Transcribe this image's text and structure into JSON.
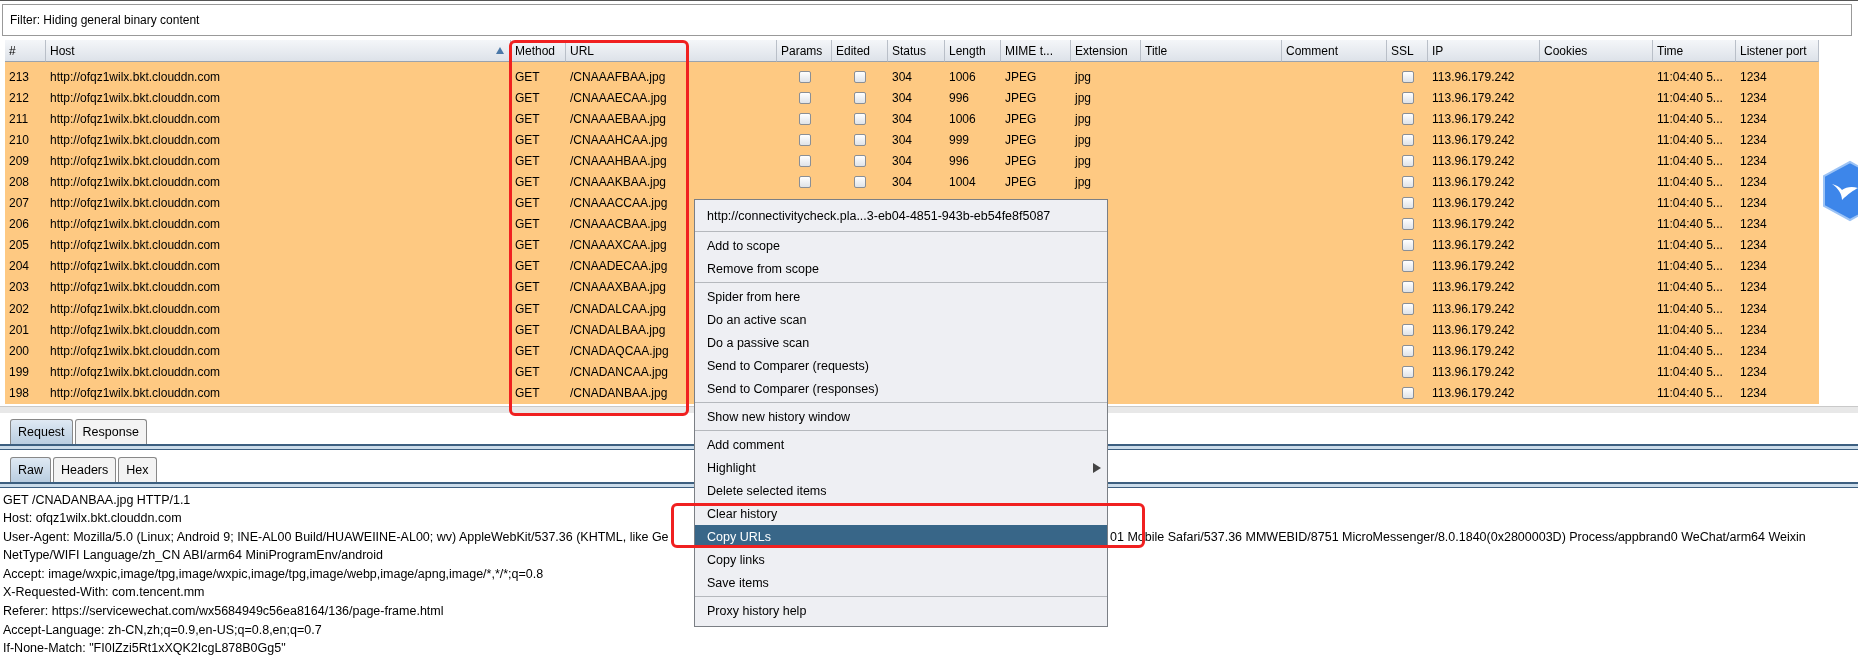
{
  "filter": {
    "text": "Filter: Hiding general binary content"
  },
  "table": {
    "columns": [
      {
        "label": "#",
        "sorted": false
      },
      {
        "label": "Host",
        "sorted": true
      },
      {
        "label": "Method",
        "sorted": false
      },
      {
        "label": "URL",
        "sorted": false
      },
      {
        "label": "Params",
        "sorted": false
      },
      {
        "label": "Edited",
        "sorted": false
      },
      {
        "label": "Status",
        "sorted": false
      },
      {
        "label": "Length",
        "sorted": false
      },
      {
        "label": "MIME t...",
        "sorted": false
      },
      {
        "label": "Extension",
        "sorted": false
      },
      {
        "label": "Title",
        "sorted": false
      },
      {
        "label": "Comment",
        "sorted": false
      },
      {
        "label": "SSL",
        "sorted": false
      },
      {
        "label": "IP",
        "sorted": false
      },
      {
        "label": "Cookies",
        "sorted": false
      },
      {
        "label": "Time",
        "sorted": false
      },
      {
        "label": "Listener port",
        "sorted": false
      }
    ],
    "rows": [
      {
        "num": "213",
        "host": "http://ofqz1wilx.bkt.clouddn.com",
        "method": "GET",
        "url": "/CNAAAFBAA.jpg",
        "params": false,
        "edited": false,
        "status": "304",
        "length": "1006",
        "mime": "JPEG",
        "extension": "jpg",
        "ssl": false,
        "ip": "113.96.179.242",
        "time": "11:04:40 5...",
        "port": "1234"
      },
      {
        "num": "212",
        "host": "http://ofqz1wilx.bkt.clouddn.com",
        "method": "GET",
        "url": "/CNAAAECAA.jpg",
        "params": false,
        "edited": false,
        "status": "304",
        "length": "996",
        "mime": "JPEG",
        "extension": "jpg",
        "ssl": false,
        "ip": "113.96.179.242",
        "time": "11:04:40 5...",
        "port": "1234"
      },
      {
        "num": "211",
        "host": "http://ofqz1wilx.bkt.clouddn.com",
        "method": "GET",
        "url": "/CNAAAEBAA.jpg",
        "params": false,
        "edited": false,
        "status": "304",
        "length": "1006",
        "mime": "JPEG",
        "extension": "jpg",
        "ssl": false,
        "ip": "113.96.179.242",
        "time": "11:04:40 5...",
        "port": "1234"
      },
      {
        "num": "210",
        "host": "http://ofqz1wilx.bkt.clouddn.com",
        "method": "GET",
        "url": "/CNAAAHCAA.jpg",
        "params": false,
        "edited": false,
        "status": "304",
        "length": "999",
        "mime": "JPEG",
        "extension": "jpg",
        "ssl": false,
        "ip": "113.96.179.242",
        "time": "11:04:40 5...",
        "port": "1234"
      },
      {
        "num": "209",
        "host": "http://ofqz1wilx.bkt.clouddn.com",
        "method": "GET",
        "url": "/CNAAAHBAA.jpg",
        "params": false,
        "edited": false,
        "status": "304",
        "length": "996",
        "mime": "JPEG",
        "extension": "jpg",
        "ssl": false,
        "ip": "113.96.179.242",
        "time": "11:04:40 5...",
        "port": "1234"
      },
      {
        "num": "208",
        "host": "http://ofqz1wilx.bkt.clouddn.com",
        "method": "GET",
        "url": "/CNAAAKBAA.jpg",
        "params": false,
        "edited": false,
        "status": "304",
        "length": "1004",
        "mime": "JPEG",
        "extension": "jpg",
        "ssl": false,
        "ip": "113.96.179.242",
        "time": "11:04:40 5...",
        "port": "1234"
      },
      {
        "num": "207",
        "host": "http://ofqz1wilx.bkt.clouddn.com",
        "method": "GET",
        "url": "/CNAAACCAA.jpg",
        "ssl": false,
        "ip": "113.96.179.242",
        "time": "11:04:40 5...",
        "port": "1234"
      },
      {
        "num": "206",
        "host": "http://ofqz1wilx.bkt.clouddn.com",
        "method": "GET",
        "url": "/CNAAACBAA.jpg",
        "ssl": false,
        "ip": "113.96.179.242",
        "time": "11:04:40 5...",
        "port": "1234"
      },
      {
        "num": "205",
        "host": "http://ofqz1wilx.bkt.clouddn.com",
        "method": "GET",
        "url": "/CNAAAXCAA.jpg",
        "ssl": false,
        "ip": "113.96.179.242",
        "time": "11:04:40 5...",
        "port": "1234"
      },
      {
        "num": "204",
        "host": "http://ofqz1wilx.bkt.clouddn.com",
        "method": "GET",
        "url": "/CNAADECAA.jpg",
        "ssl": false,
        "ip": "113.96.179.242",
        "time": "11:04:40 5...",
        "port": "1234"
      },
      {
        "num": "203",
        "host": "http://ofqz1wilx.bkt.clouddn.com",
        "method": "GET",
        "url": "/CNAAAXBAA.jpg",
        "ssl": false,
        "ip": "113.96.179.242",
        "time": "11:04:40 5...",
        "port": "1234"
      },
      {
        "num": "202",
        "host": "http://ofqz1wilx.bkt.clouddn.com",
        "method": "GET",
        "url": "/CNADALCAA.jpg",
        "ssl": false,
        "ip": "113.96.179.242",
        "time": "11:04:40 5...",
        "port": "1234"
      },
      {
        "num": "201",
        "host": "http://ofqz1wilx.bkt.clouddn.com",
        "method": "GET",
        "url": "/CNADALBAA.jpg",
        "ssl": false,
        "ip": "113.96.179.242",
        "time": "11:04:40 5...",
        "port": "1234"
      },
      {
        "num": "200",
        "host": "http://ofqz1wilx.bkt.clouddn.com",
        "method": "GET",
        "url": "/CNADAQCAA.jpg",
        "ssl": false,
        "ip": "113.96.179.242",
        "time": "11:04:40 5...",
        "port": "1234"
      },
      {
        "num": "199",
        "host": "http://ofqz1wilx.bkt.clouddn.com",
        "method": "GET",
        "url": "/CNADANCAA.jpg",
        "ssl": false,
        "ip": "113.96.179.242",
        "time": "11:04:40 5...",
        "port": "1234"
      },
      {
        "num": "198",
        "host": "http://ofqz1wilx.bkt.clouddn.com",
        "method": "GET",
        "url": "/CNADANBAA.jpg",
        "ssl": false,
        "ip": "113.96.179.242",
        "time": "11:04:40 5...",
        "port": "1234"
      }
    ]
  },
  "message_tabs": [
    {
      "label": "Request",
      "selected": true
    },
    {
      "label": "Response",
      "selected": false
    }
  ],
  "view_tabs": [
    {
      "label": "Raw",
      "selected": true
    },
    {
      "label": "Headers",
      "selected": false
    },
    {
      "label": "Hex",
      "selected": false
    }
  ],
  "request_lines": [
    {
      "kind": "plain",
      "text": "GET /CNADANBAA.jpg HTTP/1.1"
    },
    {
      "kind": "plain",
      "text": "Host: ofqz1wilx.bkt.clouddn.com"
    },
    {
      "kind": "split",
      "left": "User-Agent: Mozilla/5.0 (Linux; Android 9; INE-AL00 Build/HUAWEIINE-AL00; wv) AppleWebKit/537.36 (KHTML, like Ge",
      "right": "01 Mobile Safari/537.36 MMWEBID/8751 MicroMessenger/8.0.1840(0x2800003D) Process/appbrand0 WeChat/arm64 Weixin"
    },
    {
      "kind": "plain",
      "text": "NetType/WIFI Language/zh_CN ABI/arm64 MiniProgramEnv/android"
    },
    {
      "kind": "plain",
      "text": "Accept: image/wxpic,image/tpg,image/wxpic,image/tpg,image/webp,image/apng,image/*,*/*;q=0.8"
    },
    {
      "kind": "plain",
      "text": "X-Requested-With: com.tencent.mm"
    },
    {
      "kind": "plain",
      "text": "Referer: https://servicewechat.com/wx5684949c56ea8164/136/page-frame.html"
    },
    {
      "kind": "plain",
      "text": "Accept-Language: zh-CN,zh;q=0.9,en-US;q=0.8,en;q=0.7"
    },
    {
      "kind": "plain",
      "text": "If-None-Match: \"FI0IZzi5Rt1xXQK2IcgL878B0Gg5\""
    }
  ],
  "context_menu": {
    "groups": [
      [
        {
          "label": "http://connectivitycheck.pla...3-eb04-4851-943b-eb54fe8f5087",
          "selected": false,
          "submenu": false
        }
      ],
      [
        {
          "label": "Add to scope",
          "selected": false,
          "submenu": false
        },
        {
          "label": "Remove from scope",
          "selected": false,
          "submenu": false
        }
      ],
      [
        {
          "label": "Spider from here",
          "selected": false,
          "submenu": false
        },
        {
          "label": "Do an active scan",
          "selected": false,
          "submenu": false
        },
        {
          "label": "Do a passive scan",
          "selected": false,
          "submenu": false
        },
        {
          "label": "Send to Comparer (requests)",
          "selected": false,
          "submenu": false
        },
        {
          "label": "Send to Comparer (responses)",
          "selected": false,
          "submenu": false
        }
      ],
      [
        {
          "label": "Show new history window",
          "selected": false,
          "submenu": false
        }
      ],
      [
        {
          "label": "Add comment",
          "selected": false,
          "submenu": false
        },
        {
          "label": "Highlight",
          "selected": false,
          "submenu": true
        },
        {
          "label": "Delete selected items",
          "selected": false,
          "submenu": false
        },
        {
          "label": "Clear history",
          "selected": false,
          "submenu": false
        },
        {
          "label": "Copy URLs",
          "selected": true,
          "submenu": false
        },
        {
          "label": "Copy links",
          "selected": false,
          "submenu": false
        },
        {
          "label": "Save items",
          "selected": false,
          "submenu": false
        }
      ],
      [
        {
          "label": "Proxy history help",
          "selected": false,
          "submenu": false
        }
      ]
    ]
  },
  "annotations": [
    {
      "kind": "frame"
    },
    {
      "kind": "frame"
    }
  ]
}
